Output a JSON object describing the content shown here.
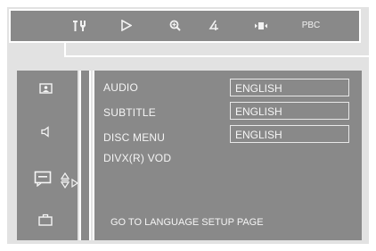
{
  "toolbar": {
    "items": [
      {
        "icon": "tools-icon"
      },
      {
        "icon": "play-icon"
      },
      {
        "icon": "zoom-icon"
      },
      {
        "icon": "angle-icon"
      },
      {
        "icon": "audio-adjust-icon"
      },
      {
        "icon": "pbc-label",
        "label": "PBC"
      }
    ]
  },
  "sidebar": {
    "items": [
      {
        "icon": "general-setup-icon"
      },
      {
        "icon": "audio-speaker-icon"
      },
      {
        "icon": "language-subtitle-icon",
        "active": true
      },
      {
        "icon": "preferences-briefcase-icon"
      }
    ]
  },
  "menu": {
    "rows": [
      {
        "label": "AUDIO",
        "value": "ENGLISH"
      },
      {
        "label": "SUBTITLE",
        "value": "ENGLISH"
      },
      {
        "label": "DISC MENU",
        "value": "ENGLISH"
      },
      {
        "label": "DIVX(R) VOD",
        "value": null
      }
    ],
    "footer": "GO TO LANGUAGE SETUP PAGE"
  },
  "colors": {
    "panel": "#898989",
    "background": "#e2e2e2",
    "text": "#f5f5f5",
    "lines": "#ffffff"
  }
}
